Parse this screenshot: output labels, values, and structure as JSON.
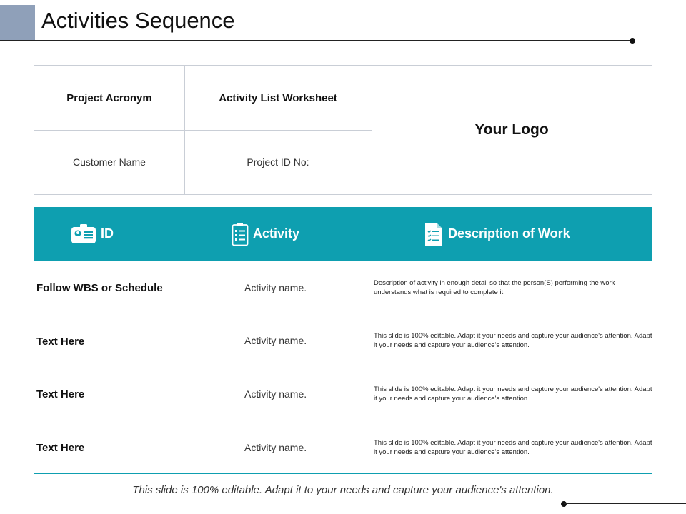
{
  "slide": {
    "title": "Activities Sequence",
    "accent_color": "#8fa0b9",
    "teal_color": "#0e9fb0"
  },
  "info_table": {
    "project_acronym": "Project Acronym",
    "activity_list_worksheet": "Activity List Worksheet",
    "customer_name": "Customer Name",
    "project_id": "Project ID No:",
    "logo": "Your Logo"
  },
  "header": {
    "id": {
      "label": "ID",
      "icon": "id-card-icon"
    },
    "activity": {
      "label": "Activity",
      "icon": "clipboard-list-icon"
    },
    "description": {
      "label": "Description of Work",
      "icon": "document-checklist-icon"
    }
  },
  "rows": [
    {
      "title": "Follow WBS or Schedule",
      "activity": "Activity name.",
      "description": "Description of activity in enough detail so that the person(S) performing the work understands what is required to complete it."
    },
    {
      "title": "Text Here",
      "activity": "Activity name.",
      "description": "This slide is 100% editable. Adapt it your needs and capture your audience's attention. Adapt it your needs and capture your audience's attention."
    },
    {
      "title": "Text Here",
      "activity": "Activity name.",
      "description": "This slide is 100% editable. Adapt it your needs and capture your audience's attention. Adapt it your needs and capture your audience's attention."
    },
    {
      "title": "Text Here",
      "activity": "Activity name.",
      "description": "This slide is 100% editable. Adapt it your needs and capture your audience's attention. Adapt it your needs and capture your audience's attention."
    }
  ],
  "footer": {
    "text": "This slide is 100% editable. Adapt it to your needs and capture your audience's attention."
  }
}
